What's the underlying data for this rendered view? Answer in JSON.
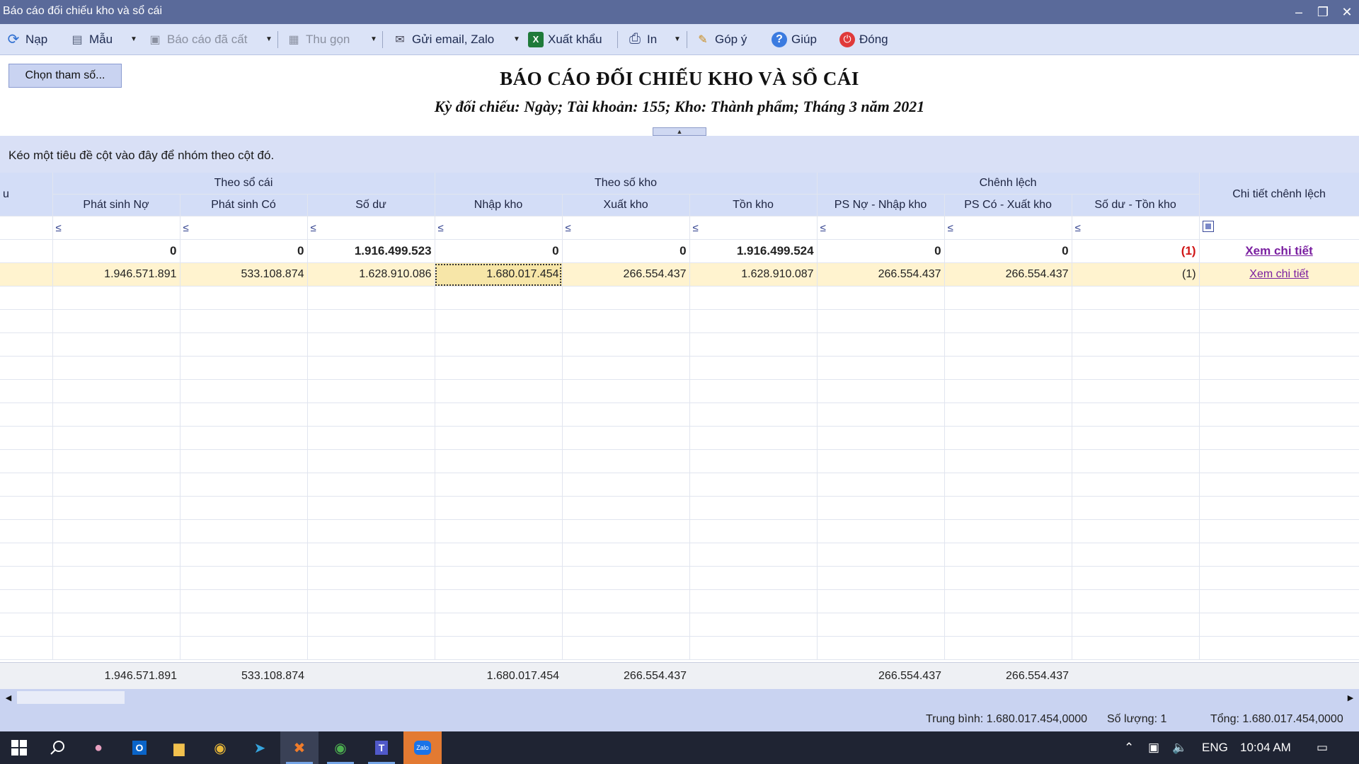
{
  "window": {
    "title": "Báo cáo đối chiếu kho và sổ cái",
    "buttons": [
      "–",
      "❐",
      "✕"
    ]
  },
  "toolbar": {
    "items": [
      {
        "label": "Nạp",
        "icon": "refresh-icon",
        "icon_glyph": "⟳",
        "color": "#2f6fd1"
      },
      {
        "label": "Mẫu",
        "icon": "template-icon",
        "icon_glyph": "▤",
        "color": "#55607a"
      },
      {
        "label": "Báo cáo đã cất",
        "icon": "save-icon",
        "icon_glyph": "▣",
        "color": "#8a90a0"
      },
      {
        "label": "Thu gọn",
        "icon": "collapse-icon",
        "icon_glyph": "▦",
        "color": "#8a90a0"
      },
      {
        "label": "Gửi email, Zalo",
        "icon": "email-icon",
        "icon_glyph": "✉",
        "color": "#445"
      },
      {
        "label": "Xuất khẩu",
        "icon": "excel-icon",
        "icon_glyph": "X",
        "color": "#1f7a3a"
      },
      {
        "label": "In",
        "icon": "print-icon",
        "icon_glyph": "⎙",
        "color": "#3a4a7a"
      },
      {
        "label": "Góp ý",
        "icon": "feedback-icon",
        "icon_glyph": "✎",
        "color": "#c98a1a"
      },
      {
        "label": "Giúp",
        "icon": "help-icon",
        "icon_glyph": "?",
        "color": "#3b7be0"
      },
      {
        "label": "Đóng",
        "icon": "power-icon",
        "icon_glyph": "⏻",
        "color": "#e03a3a"
      }
    ]
  },
  "params_button": "Chọn tham số...",
  "report": {
    "title": "BÁO CÁO ĐỐI CHIẾU KHO VÀ SỔ CÁI",
    "subtitle": "Kỳ đối chiếu: Ngày; Tài khoản: 155; Kho: Thành phẩm; Tháng 3 năm 2021"
  },
  "group_hint": "Kéo một tiêu đề cột vào đây để nhóm theo cột đó.",
  "grid": {
    "first_col_header": "u",
    "groups": [
      "Theo sổ cái",
      "Theo số kho",
      "Chênh lệch"
    ],
    "detail_header": "Chi tiết chênh lệch",
    "columns": [
      "Phát sinh Nợ",
      "Phát sinh Có",
      "Số dư",
      "Nhập kho",
      "Xuất kho",
      "Tồn kho",
      "PS Nợ - Nhập kho",
      "PS Có - Xuất kho",
      "Số dư - Tồn kho"
    ],
    "filter_op": "≤",
    "summary_row": [
      "0",
      "0",
      "1.916.499.523",
      "0",
      "0",
      "1.916.499.524",
      "0",
      "0",
      "(1)"
    ],
    "data_row": [
      "1.946.571.891",
      "533.108.874",
      "1.628.910.086",
      "1.680.017.454",
      "266.554.437",
      "1.628.910.087",
      "266.554.437",
      "266.554.437",
      "(1)"
    ],
    "link_text": "Xem chi tiết"
  },
  "footer_totals": [
    "1.946.571.891",
    "533.108.874",
    "",
    "1.680.017.454",
    "266.554.437",
    "",
    "266.554.437",
    "266.554.437",
    ""
  ],
  "status": {
    "average": "Trung bình: 1.680.017.454,0000",
    "count": "Số lượng: 1",
    "total": "Tổng: 1.680.017.454,0000"
  },
  "taskbar": {
    "apps": [
      "windows-start-icon",
      "search-icon",
      "paint-icon",
      "outlook-icon",
      "file-explorer-icon",
      "chrome-icon",
      "telegram-icon",
      "misa-icon",
      "chrome-icon",
      "teams-icon",
      "zalo-icon"
    ],
    "language": "ENG",
    "time": "10:04 AM",
    "zalo_label": "Zalo"
  }
}
